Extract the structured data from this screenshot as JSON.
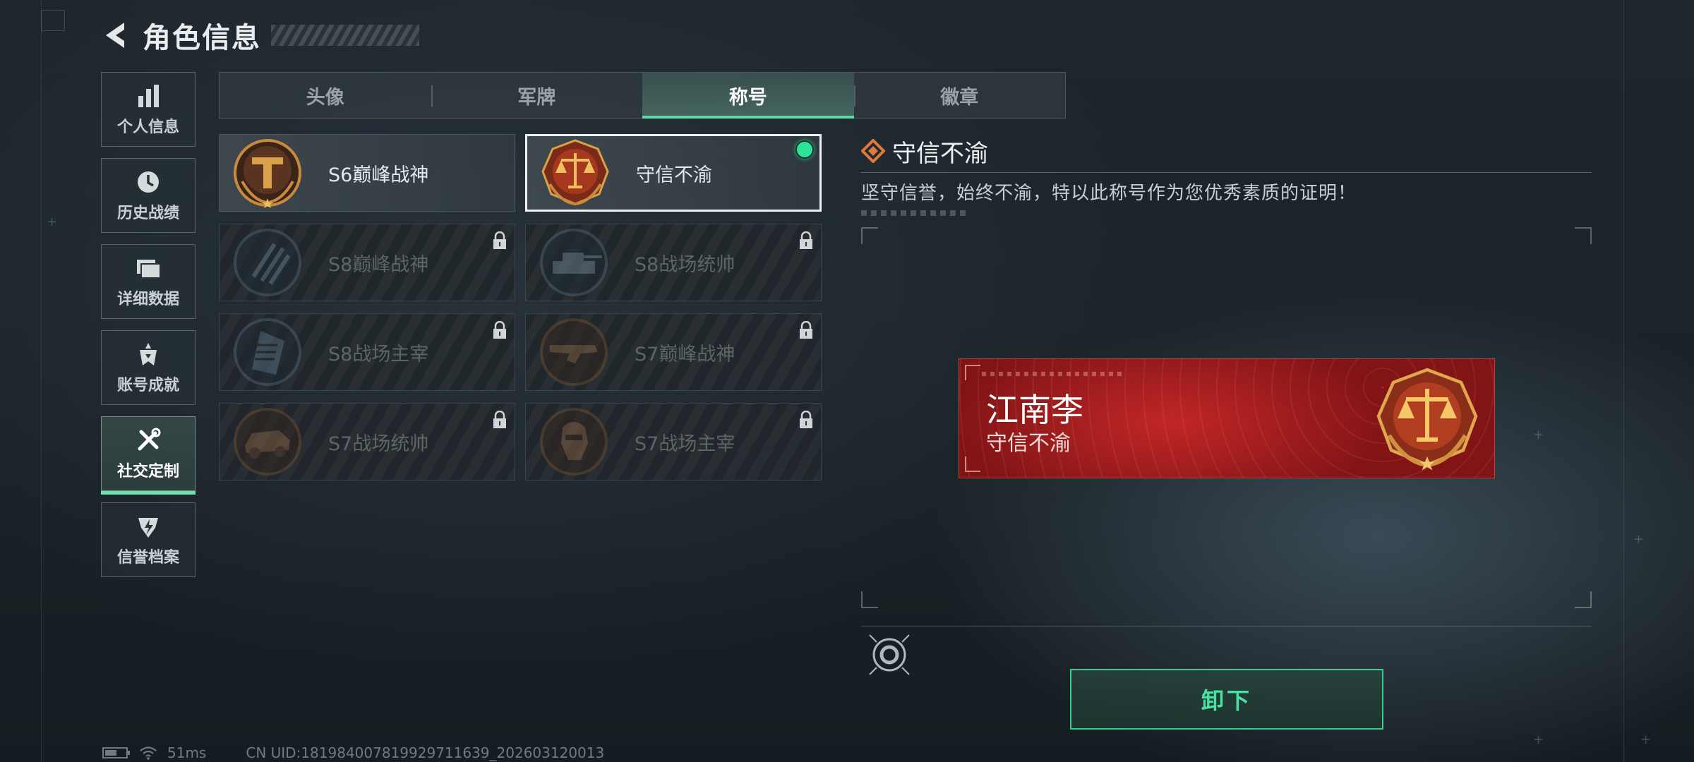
{
  "header": {
    "title": "角色信息"
  },
  "nav": {
    "items": [
      {
        "label": "个人信息",
        "icon": "bar-chart-icon",
        "active": false
      },
      {
        "label": "历史战绩",
        "icon": "history-clock-icon",
        "active": false
      },
      {
        "label": "详细数据",
        "icon": "folder-icon",
        "active": false
      },
      {
        "label": "账号成就",
        "icon": "achievement-badge-icon",
        "active": false
      },
      {
        "label": "社交定制",
        "icon": "tools-icon",
        "active": true
      },
      {
        "label": "信誉档案",
        "icon": "shield-bolt-icon",
        "active": false
      }
    ]
  },
  "tabs": [
    {
      "label": "头像",
      "active": false
    },
    {
      "label": "军牌",
      "active": false
    },
    {
      "label": "称号",
      "active": true
    },
    {
      "label": "徽章",
      "active": false
    }
  ],
  "titles": [
    {
      "name": "S6巅峰战神",
      "locked": false,
      "selected": false,
      "equipped": false,
      "emblem": "peak-war-god-emblem-icon"
    },
    {
      "name": "守信不渝",
      "locked": false,
      "selected": true,
      "equipped": true,
      "emblem": "justice-scales-emblem-icon"
    },
    {
      "name": "S8巅峰战神",
      "locked": true,
      "emblem": "stripes-emblem-icon"
    },
    {
      "name": "S8战场统帅",
      "locked": true,
      "emblem": "tank-emblem-icon"
    },
    {
      "name": "S8战场主宰",
      "locked": true,
      "emblem": "building-emblem-icon"
    },
    {
      "name": "S7巅峰战神",
      "locked": true,
      "emblem": "rifle-emblem-icon"
    },
    {
      "name": "S7战场统帅",
      "locked": true,
      "emblem": "vehicle-emblem-icon"
    },
    {
      "name": "S7战场主宰",
      "locked": true,
      "emblem": "soldier-emblem-icon"
    }
  ],
  "detail": {
    "title": "守信不渝",
    "description": "坚守信誉，始终不渝，特以此称号作为您优秀素质的证明！"
  },
  "plate": {
    "player_name": "江南李",
    "title": "守信不渝"
  },
  "actions": {
    "unequip_label": "卸下"
  },
  "status": {
    "ping": "51ms",
    "uid": "CN UID:181984007819929711639_202603120013"
  },
  "colors": {
    "accent_green": "#46e3a2",
    "plate_red": "#b5262a",
    "emblem_gold": "#d9a24a"
  }
}
